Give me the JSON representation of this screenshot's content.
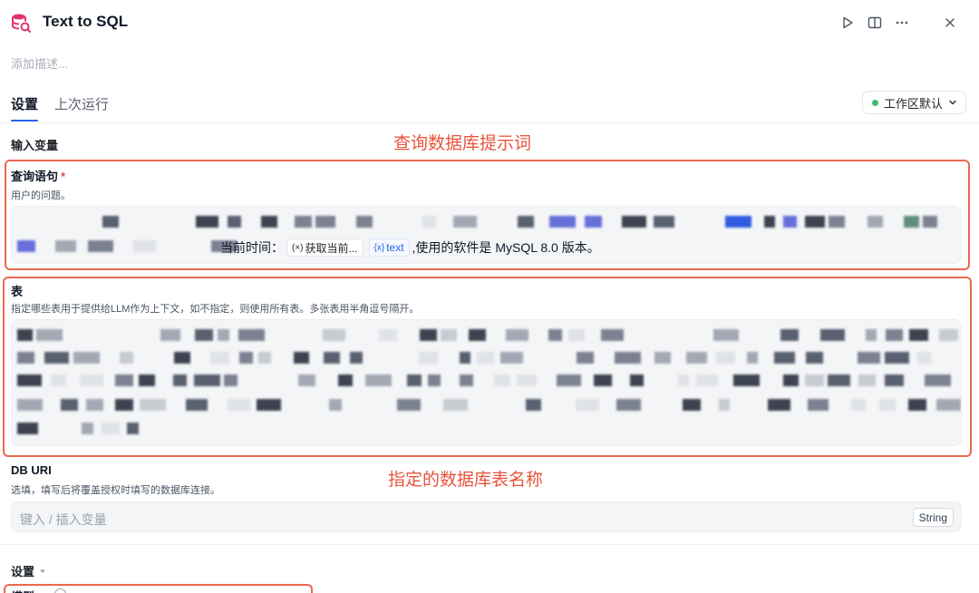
{
  "app": {
    "title": "Text to SQL",
    "icon": "database-search-icon",
    "description_placeholder": "添加描述..."
  },
  "header_actions": [
    {
      "name": "run",
      "icon": "play-icon"
    },
    {
      "name": "docs",
      "icon": "book-icon"
    },
    {
      "name": "more",
      "icon": "more-horizontal-icon"
    },
    {
      "name": "close",
      "icon": "close-icon"
    }
  ],
  "tabs": [
    {
      "label": "设置",
      "active": true
    },
    {
      "label": "上次运行",
      "active": false
    }
  ],
  "workspace_select": {
    "label": "工作区默认",
    "status_color": "#3fbf6d"
  },
  "section_input_vars": "输入变量",
  "annotations": {
    "query_prompt": "查询数据库提示词",
    "table_names": "指定的数据库表名称"
  },
  "query_field": {
    "label": "查询语句",
    "required_mark": "*",
    "help": "用户的问题。",
    "visible_text_prefix": "当前时间：",
    "chip_time": "获取当前...",
    "chip_time_glyph": "(×)",
    "chip_var": "text",
    "chip_var_glyph": "{x}",
    "visible_text_suffix": ",使用的软件是 MySQL 8.0 版本。"
  },
  "table_field": {
    "label": "表",
    "help": "指定哪些表用于提供给LLM作为上下文，如不指定，则使用所有表。多张表用半角逗号隔开。"
  },
  "db_uri_field": {
    "label": "DB URI",
    "help": "选填，填写后将覆盖授权时填写的数据库连接。",
    "placeholder": "键入 / 插入变量",
    "type_badge": "String"
  },
  "settings_section": {
    "label": "设置",
    "chevron": "caret-down-icon"
  },
  "bottom_field": {
    "label": "模型"
  },
  "colors": {
    "accent": "#2563eb",
    "annotation_red": "#e8543c",
    "required_red": "#e5484d",
    "status_green": "#3fbf6d",
    "app_icon_pink": "#e2336b"
  }
}
